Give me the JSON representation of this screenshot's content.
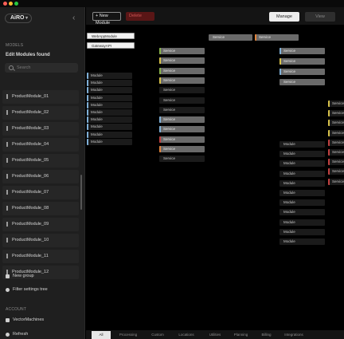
{
  "window": {
    "dots": [
      "#ff5f57",
      "#febc2e",
      "#28c840"
    ]
  },
  "sidebar": {
    "logo": "AiRO",
    "section_label": "MODELS",
    "model_title": "Edit Modules found",
    "search_placeholder": "Search",
    "items": [
      {
        "label": "ProductModule_01"
      },
      {
        "label": "ProductModule_02"
      },
      {
        "label": "ProductModule_03"
      },
      {
        "label": "ProductModule_04"
      },
      {
        "label": "ProductModule_05"
      },
      {
        "label": "ProductModule_06"
      },
      {
        "label": "ProductModule_07"
      },
      {
        "label": "ProductModule_08"
      },
      {
        "label": "ProductModule_09"
      },
      {
        "label": "ProductModule_10"
      },
      {
        "label": "ProductModule_11"
      },
      {
        "label": "ProductModule_12"
      }
    ],
    "new_group": "New group",
    "filter_settings": "Filter settings tree",
    "section2_label": "ACCOUNT",
    "account": "VectorMachines",
    "refresh": "Refresh"
  },
  "toolbar": {
    "new_button": "+ New Module",
    "delete_button": "Delete",
    "mode_a": "Manage",
    "mode_b": "View"
  },
  "canvas": {
    "white_nodes": [
      "WebAppModule",
      "GatewayAPI"
    ],
    "nodes_col1": [
      "Module",
      "Module",
      "Module",
      "Module",
      "Module",
      "Module",
      "Module",
      "Module",
      "Module",
      "Module"
    ],
    "nodes_col2": [
      "Service",
      "Service",
      "Service",
      "Service",
      "Service",
      "Service",
      "Service",
      "Service",
      "Service",
      "Service",
      "Service",
      "Service"
    ],
    "top_nodes": [
      "Service",
      "Service"
    ],
    "nodes_col3": [
      "Service",
      "Service",
      "Service",
      "Service"
    ],
    "nodes_col4": [
      "Module",
      "Module",
      "Module",
      "Module",
      "Module",
      "Module",
      "Module",
      "Module",
      "Module",
      "Module",
      "Module"
    ],
    "nodes_col5": [
      "Service",
      "Service",
      "Service",
      "Service",
      "Service",
      "Service",
      "Service",
      "Service",
      "Service"
    ]
  },
  "bottom_tabs": [
    "All",
    "Processing",
    "Custom",
    "Locations",
    "Utilities",
    "Planning",
    "Billing",
    "Integrations"
  ],
  "colors": {
    "accent_orange": "#e0823a",
    "accent_yellow": "#d8c24a",
    "accent_blue": "#7fb0d8",
    "accent_red": "#c04040",
    "accent_green": "#88b34a"
  }
}
